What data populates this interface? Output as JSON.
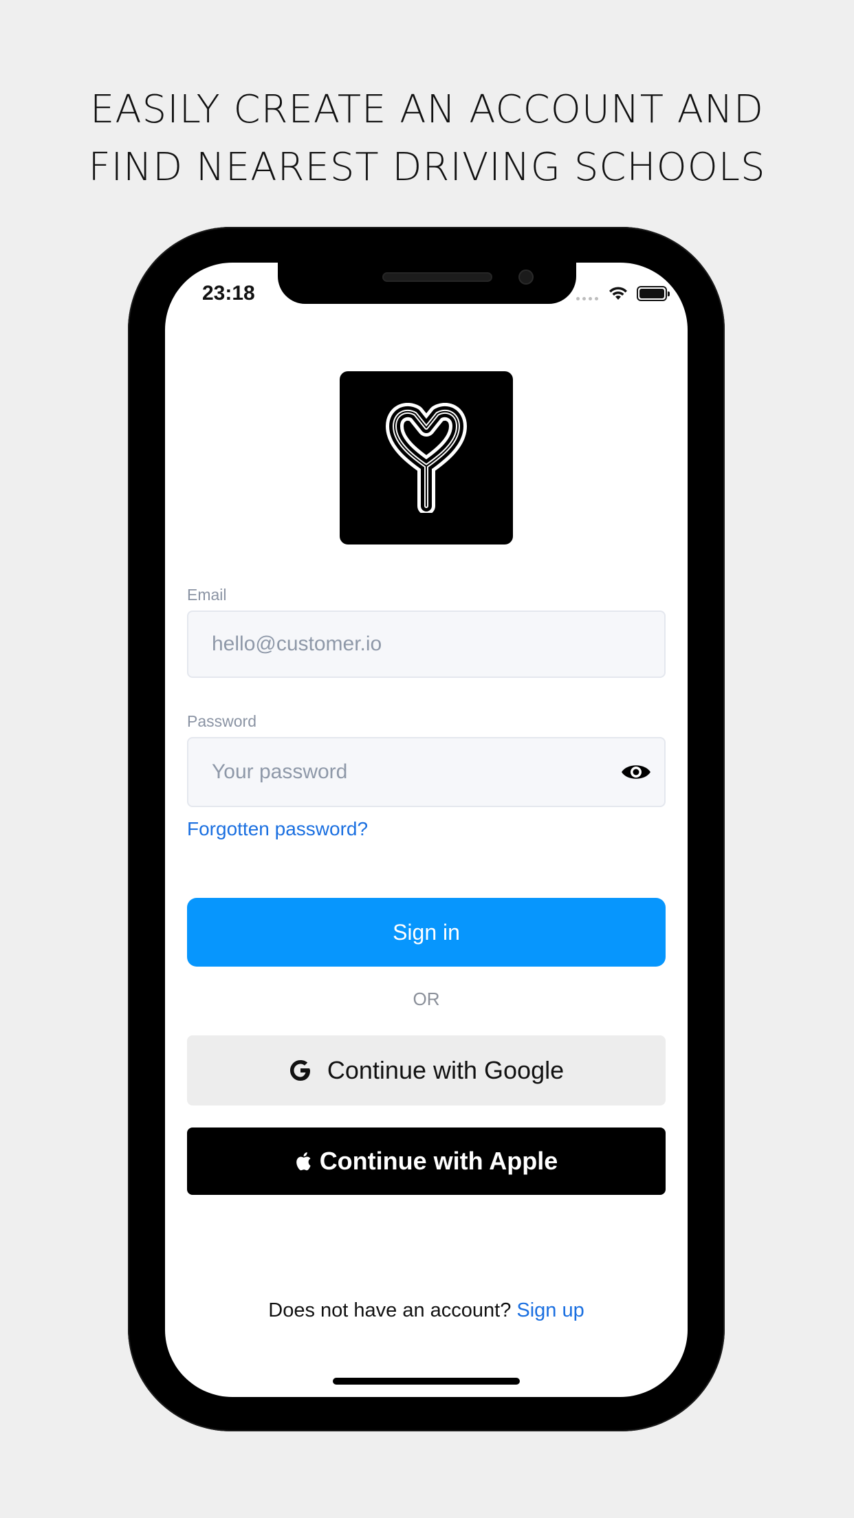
{
  "headline": {
    "line1": "EASILY CREATE AN ACCOUNT AND",
    "line2": "FIND NEAREST DRIVING SCHOOLS"
  },
  "status_bar": {
    "time": "23:18"
  },
  "logo": {
    "icon": "y-logo-icon"
  },
  "form": {
    "email_label": "Email",
    "email_placeholder": "hello@customer.io",
    "password_label": "Password",
    "password_placeholder": "Your password",
    "forgot_link": "Forgotten password?",
    "signin_button": "Sign in",
    "or_divider": "OR",
    "google_button": "Continue with Google",
    "apple_button": "Continue with Apple"
  },
  "footer": {
    "prompt": "Does not have an account?",
    "signup_link": "Sign up"
  },
  "colors": {
    "background": "#efefef",
    "primary_button": "#0796fd",
    "link": "#1a6fe0",
    "google_button_bg": "#ededed",
    "apple_button_bg": "#000000"
  }
}
